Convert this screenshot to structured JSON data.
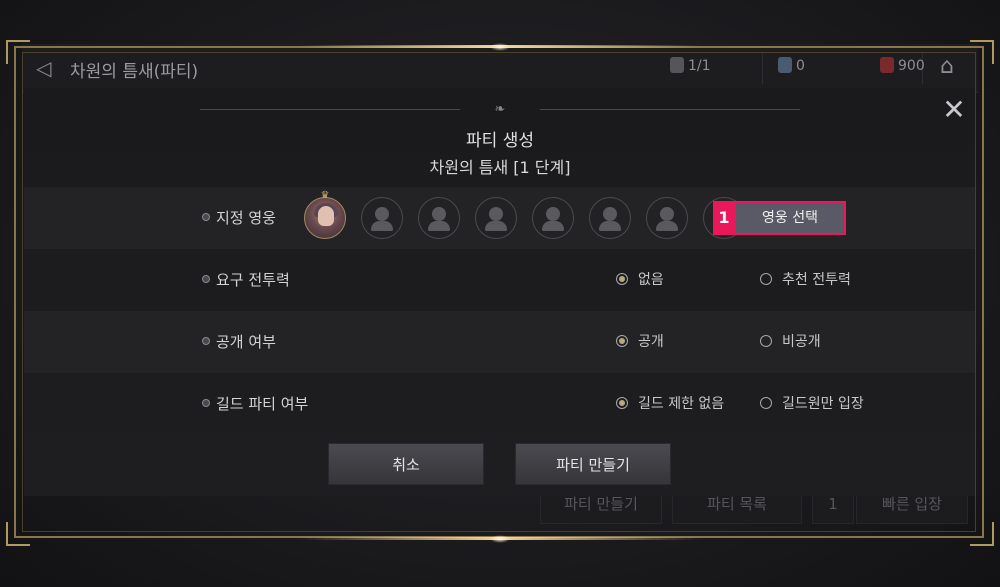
{
  "background": {
    "top_title": "차원의 틈새(파티)",
    "resources": [
      {
        "icon": "ticket-icon",
        "value": "1/1"
      },
      {
        "icon": "crystal-icon",
        "value": "0"
      },
      {
        "icon": "red-book-icon",
        "value": "900"
      }
    ],
    "buttons": [
      "파티 만들기",
      "파티 목록",
      "1",
      "빠른 입장"
    ]
  },
  "dialog": {
    "title": "파티 생성",
    "subtitle": "차원의 틈새 [1 단계]",
    "rows": {
      "hero": {
        "label": "지정 영웅",
        "select_button": "영웅 선택",
        "marker": "1"
      },
      "power": {
        "label": "요구 전투력",
        "option1": "없음",
        "option2": "추천 전투력",
        "selected": "없음"
      },
      "public": {
        "label": "공개 여부",
        "option1": "공개",
        "option2": "비공개",
        "selected": "공개"
      },
      "guild": {
        "label": "길드 파티 여부",
        "option1": "길드 제한 없음",
        "option2": "길드원만 입장",
        "selected": "길드 제한 없음"
      }
    },
    "buttons": {
      "cancel": "취소",
      "create": "파티 만들기"
    }
  },
  "colors": {
    "accent": "#e8185a",
    "frame_gold": "#8a7648",
    "radio_selected": "#b8a87a"
  }
}
